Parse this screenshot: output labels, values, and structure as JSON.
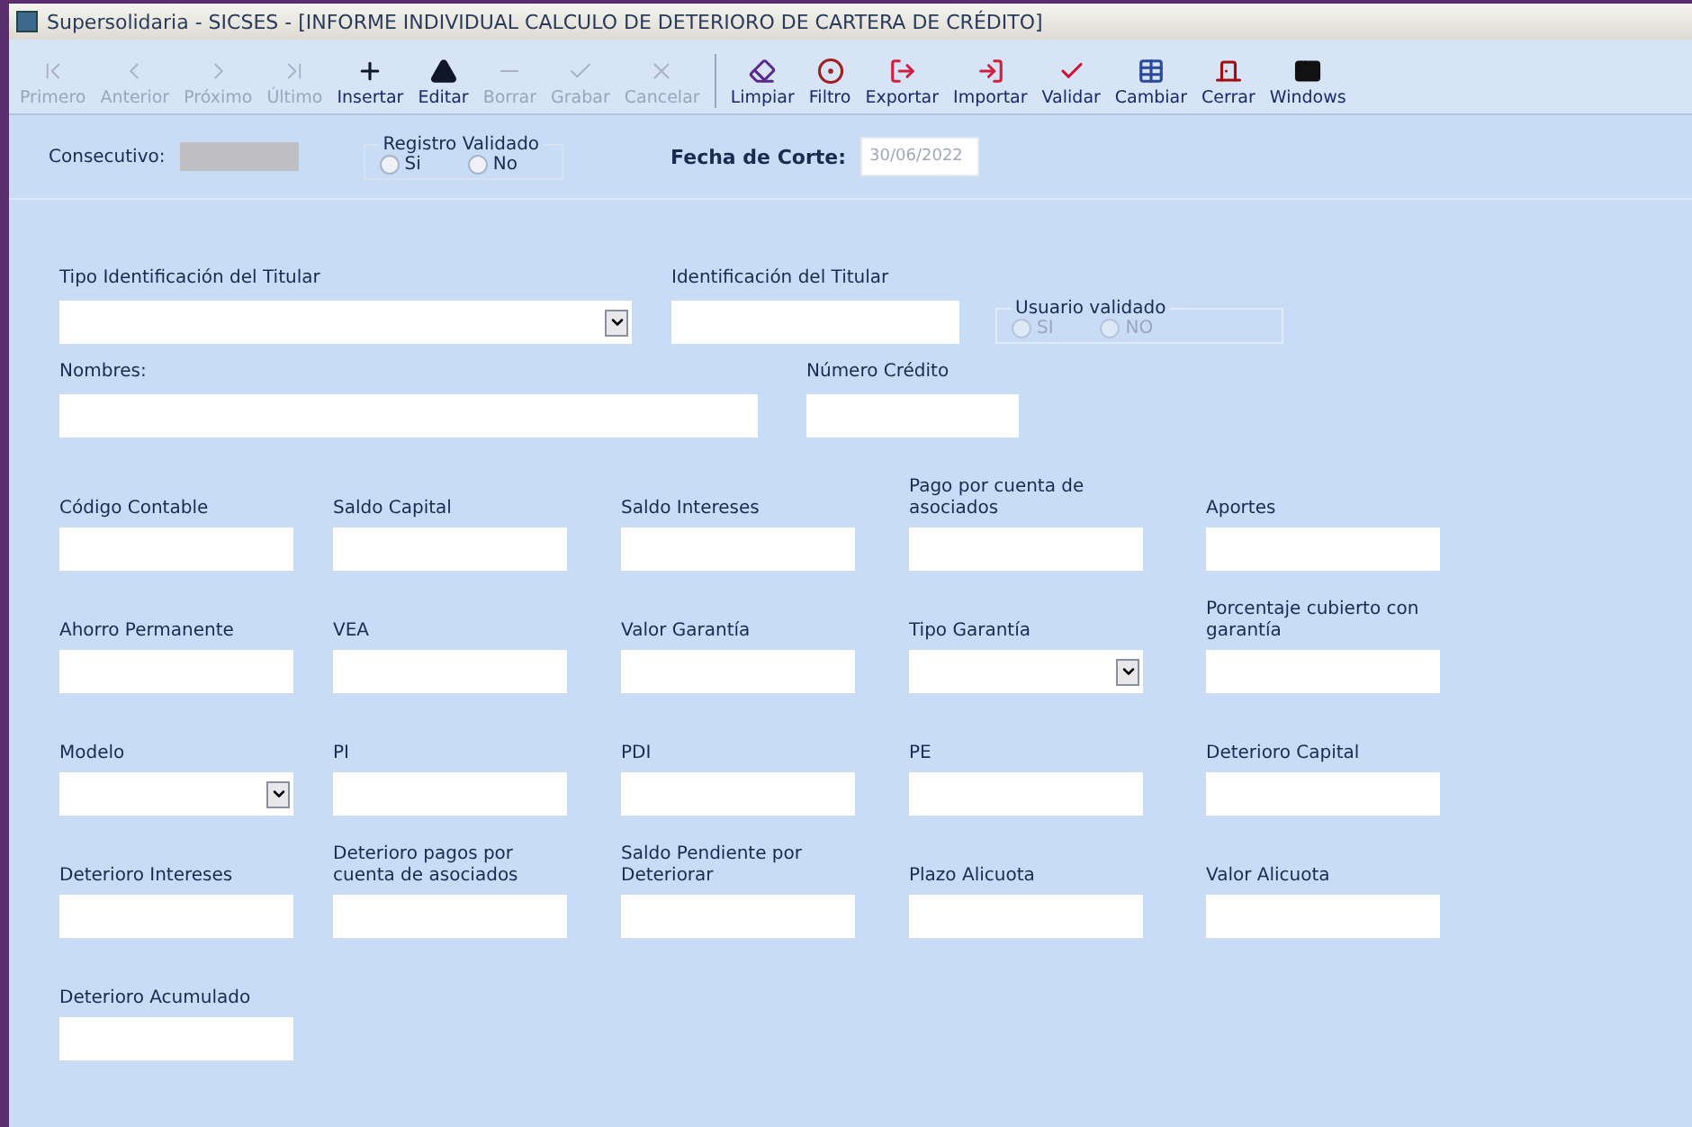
{
  "window": {
    "title": "Supersolidaria - SICSES - [INFORME INDIVIDUAL CALCULO DE DETERIORO DE CARTERA DE CRÉDITO]"
  },
  "toolbar_groups": [
    [
      {
        "label": "Primero",
        "kind": "first",
        "disabled": true
      },
      {
        "label": "Anterior",
        "kind": "prev",
        "disabled": true
      },
      {
        "label": "Próximo",
        "kind": "next",
        "disabled": true
      },
      {
        "label": "Último",
        "kind": "last",
        "disabled": true
      },
      {
        "label": "Insertar",
        "kind": "plus",
        "disabled": false
      },
      {
        "label": "Editar",
        "kind": "up",
        "disabled": false
      },
      {
        "label": "Borrar",
        "kind": "minus",
        "disabled": true
      },
      {
        "label": "Grabar",
        "kind": "check",
        "disabled": true
      },
      {
        "label": "Cancelar",
        "kind": "x",
        "disabled": true
      }
    ],
    [
      {
        "label": "Limpiar",
        "kind": "eraser",
        "disabled": false
      },
      {
        "label": "Filtro",
        "kind": "filter",
        "disabled": false
      },
      {
        "label": "Exportar",
        "kind": "export",
        "disabled": false
      },
      {
        "label": "Importar",
        "kind": "import",
        "disabled": false
      },
      {
        "label": "Validar",
        "kind": "validate",
        "disabled": false
      },
      {
        "label": "Cambiar",
        "kind": "grid",
        "disabled": false
      },
      {
        "label": "Cerrar",
        "kind": "door",
        "disabled": false
      },
      {
        "label": "Windows",
        "kind": "window",
        "disabled": false
      }
    ]
  ],
  "header": {
    "consecutivo": {
      "label": "Consecutivo:",
      "disabled": true
    },
    "registro_validado": {
      "title": "Registro Validado",
      "options": [
        {
          "label": "Si",
          "selected": false
        },
        {
          "label": "No",
          "selected": false
        }
      ]
    },
    "fecha_corte": {
      "label": "Fecha de Corte:",
      "value": "30/06/2022"
    }
  },
  "titular": {
    "tipo": {
      "label": "Tipo Identificación del Titular",
      "kind": "combo"
    },
    "identificacion": {
      "label": "Identificación del Titular",
      "kind": "text"
    },
    "usuario_validado": {
      "title": "Usuario validado",
      "disabled": true,
      "options": [
        {
          "label": "SI",
          "selected": false
        },
        {
          "label": "NO",
          "selected": false
        }
      ]
    },
    "nombres": {
      "label": "Nombres:",
      "kind": "text"
    },
    "numero_credito": {
      "label": "Número Crédito",
      "kind": "text"
    }
  },
  "rows": [
    [
      {
        "label": "Código Contable",
        "kind": "text"
      },
      {
        "label": "Saldo Capital",
        "kind": "text"
      },
      {
        "label": "Saldo Intereses",
        "kind": "text"
      },
      {
        "label": "Pago por cuenta de asociados",
        "kind": "text"
      },
      {
        "label": "Aportes",
        "kind": "text"
      }
    ],
    [
      {
        "label": "Ahorro Permanente",
        "kind": "text"
      },
      {
        "label": "VEA",
        "kind": "text"
      },
      {
        "label": "Valor Garantía",
        "kind": "text"
      },
      {
        "label": "Tipo Garantía",
        "kind": "combo"
      },
      {
        "label": "Porcentaje cubierto con garantía",
        "kind": "text"
      }
    ],
    [
      {
        "label": "Modelo",
        "kind": "combo"
      },
      {
        "label": "PI",
        "kind": "text"
      },
      {
        "label": "PDI",
        "kind": "text"
      },
      {
        "label": "PE",
        "kind": "text"
      },
      {
        "label": "Deterioro Capital",
        "kind": "text"
      }
    ],
    [
      {
        "label": "Deterioro Intereses",
        "kind": "text"
      },
      {
        "label": "Deterioro pagos por cuenta de asociados",
        "kind": "text"
      },
      {
        "label": "Saldo Pendiente por Deteriorar",
        "kind": "text"
      },
      {
        "label": "Plazo Alicuota",
        "kind": "text"
      },
      {
        "label": "Valor Alicuota",
        "kind": "text"
      }
    ],
    [
      {
        "label": "Deterioro Acumulado",
        "kind": "text"
      }
    ]
  ]
}
